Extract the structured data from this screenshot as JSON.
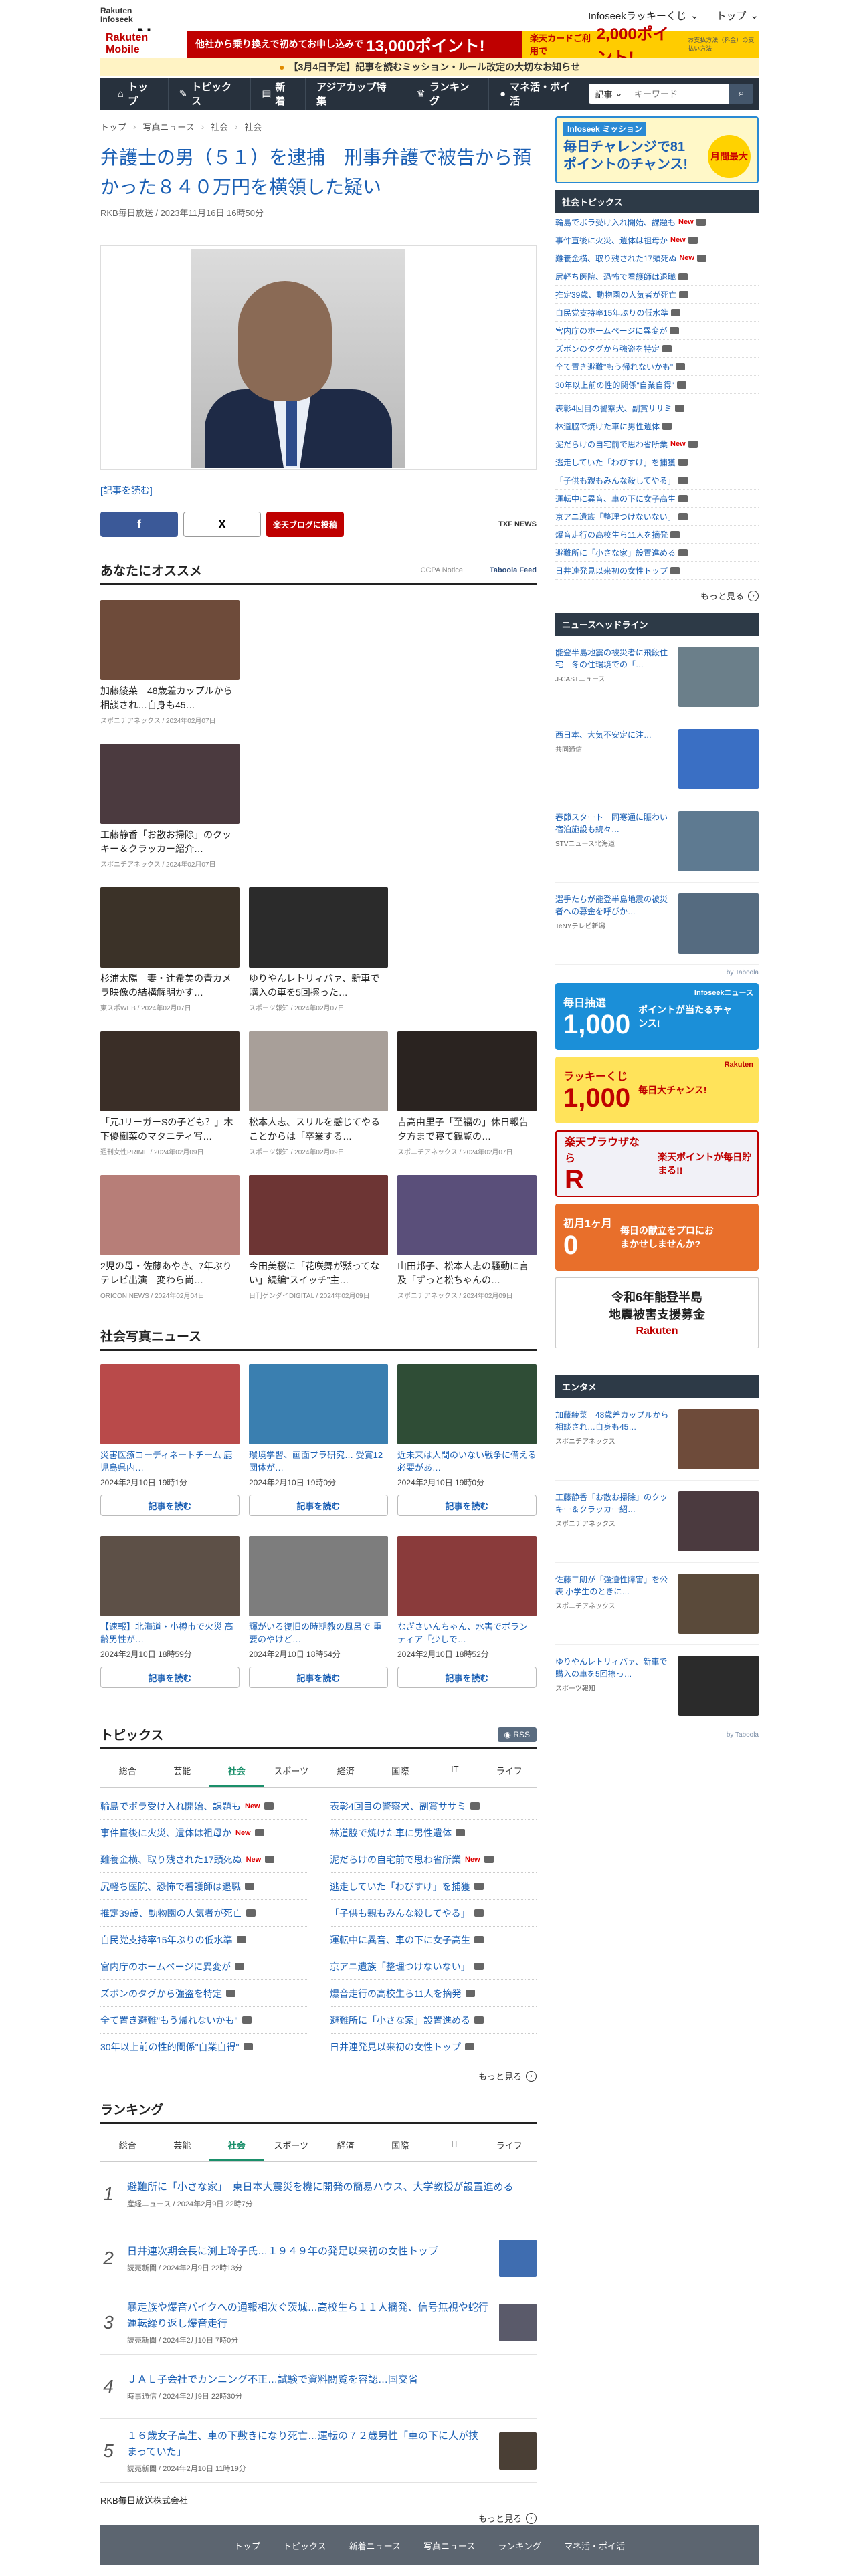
{
  "header": {
    "logo_top": "Rakuten\nInfoseek",
    "logo_main": "News",
    "lucky": "Infoseekラッキーくじ",
    "top": "トップ"
  },
  "banner": {
    "mobile": "Rakuten Mobile",
    "promo_pre": "他社から乗り換えで初めてお申し込みで",
    "promo_pts": "13,000ポイント!",
    "right_pre": "楽天カードご利用で",
    "right_pts": "2,000ポイント!",
    "right_note": "お支払方法（料金）の支払い方法"
  },
  "notice": "【3月4日予定】記事を読むミッション・ルール改定の大切なお知らせ",
  "nav": {
    "items": [
      "トップ",
      "トピックス",
      "新着",
      "アジアカップ特集",
      "ランキング",
      "マネ活・ポイ活"
    ],
    "search_select": "記事",
    "search_placeholder": "キーワード"
  },
  "article": {
    "breadcrumb": [
      "トップ",
      "写真ニュース",
      "社会",
      "社会"
    ],
    "title": "弁護士の男（５１）を逮捕　刑事弁護で被告から預かった８４０万円を横領した疑い",
    "meta": "RKB毎日放送 / 2023年11月16日 16時50分",
    "read_more": "[記事を読む]",
    "share": {
      "fb": "f",
      "x": "X",
      "blog": "楽天ブログに投稿",
      "logo": "TXF NEWS"
    }
  },
  "recommend": {
    "title": "あなたにオススメ",
    "notice": "CCPA Notice",
    "feed": "Taboola Feed",
    "cards": [
      {
        "title": "加藤綾菜　48歳差カップルから相談され…自身も45…",
        "src": "スポニチアネックス / 2024年02月07日",
        "c": "#6e4b3a"
      },
      {
        "title": "工藤静香「お散お掃除」のクッキー＆クラッカー紹介…",
        "src": "スポニチアネックス / 2024年02月07日",
        "c": "#4b3a3f"
      },
      {
        "title": "杉浦太陽　妻・辻希美の青カメラ映像の結構解明かす…",
        "src": "東スポWEB / 2024年02月07日",
        "c": "#3b3228"
      },
      {
        "title": "ゆりやんレトリィバァ、新車で購入の車を5回擦った…",
        "src": "スポーツ報知 / 2024年02月07日",
        "c": "#2b2b2b"
      },
      {
        "title": "「元JリーガーSの子ども？」木下優樹菜のマタニティ写…",
        "src": "週刊女性PRIME / 2024年02月09日",
        "c": "#3a2e27"
      },
      {
        "title": "松本人志、スリルを感じてやることからは「卒業する…",
        "src": "スポーツ報知 / 2024年02月09日",
        "c": "#a89f99"
      },
      {
        "title": "吉高由里子「至福の」休日報告　夕方まで寝て観覧の…",
        "src": "スポニチアネックス / 2024年02月07日",
        "c": "#2a2320"
      },
      {
        "title": "2児の母・佐藤あやき、7年ぶりテレビ出演　変わら尚…",
        "src": "ORICON NEWS / 2024年02月04日",
        "c": "#b77e78"
      },
      {
        "title": "今田美桜に「花咲舞が黙ってない」続編“スイッチ”主…",
        "src": "日刊ゲンダイDIGITAL / 2024年02月09日",
        "c": "#6d3534"
      },
      {
        "title": "山田邦子、松本人志の騒動に言及「ずっと松ちゃんの…",
        "src": "スポニチアネックス / 2024年02月09日",
        "c": "#5a4f7a"
      }
    ]
  },
  "photonews": {
    "title": "社会写真ニュース",
    "btn": "記事を読む",
    "items": [
      {
        "title": "災害医療コーディネートチーム 鹿児島県内…",
        "date": "2024年2月10日 19時1分",
        "c": "#b94a4a"
      },
      {
        "title": "環境学習、画面プラ研究… 受賞12団体が…",
        "date": "2024年2月10日 19時0分",
        "c": "#3a7fb0"
      },
      {
        "title": "近未来は人間のいない戦争に備える必要があ…",
        "date": "2024年2月10日 19時0分",
        "c": "#2f4d36"
      },
      {
        "title": "【速報】北海道・小樽市で火災 高齢男性が…",
        "date": "2024年2月10日 18時59分",
        "c": "#5d5047"
      },
      {
        "title": "輝がいる復旧の時期教の風呂で 重要のやけど…",
        "date": "2024年2月10日 18時54分",
        "c": "#7d7d7d"
      },
      {
        "title": "なぎさいんちゃん、水害でボランティア「少しで…",
        "date": "2024年2月10日 18時52分",
        "c": "#8a3b3b"
      }
    ]
  },
  "topics": {
    "title": "トピックス",
    "rss": "RSS",
    "tabs": [
      "総合",
      "芸能",
      "社会",
      "スポーツ",
      "経済",
      "国際",
      "IT",
      "ライフ"
    ],
    "active": "社会",
    "left": [
      {
        "t": "輪島でボラ受け入れ開始、課題も",
        "new": "New"
      },
      {
        "t": "事件直後に火災、遺体は祖母か",
        "new": "New"
      },
      {
        "t": "難養金横、取り残された17頭死ぬ",
        "new": "New"
      },
      {
        "t": "尻軽ち医院、恐怖で看護師は退職",
        "new": ""
      },
      {
        "t": "推定39歳、動物園の人気者が死亡",
        "new": ""
      },
      {
        "t": "自民党支持率15年ぶりの低水準",
        "new": ""
      },
      {
        "t": "宮内庁のホームページに異変が",
        "new": ""
      },
      {
        "t": "ズボンのタグから強盗を特定",
        "new": ""
      },
      {
        "t": "全て置き避難\"もう帰れないかも\"",
        "new": ""
      },
      {
        "t": "30年以上前の性的関係\"自業自得\"",
        "new": ""
      }
    ],
    "right": [
      {
        "t": "表彰4回目の警察犬、副賞ササミ",
        "new": ""
      },
      {
        "t": "林道脇で焼けた車に男性遺体",
        "new": ""
      },
      {
        "t": "泥だらけの自宅前で思わ省所業",
        "new": "New"
      },
      {
        "t": "逃走していた「わびすけ」を捕獲",
        "new": ""
      },
      {
        "t": "「子供も親もみんな殺してやる」",
        "new": ""
      },
      {
        "t": "運転中に異音、車の下に女子高生",
        "new": ""
      },
      {
        "t": "京アニ遺族「整理つけないない」",
        "new": ""
      },
      {
        "t": "爆音走行の高校生ら11人を摘発",
        "new": ""
      },
      {
        "t": "避難所に「小さな家」設置進める",
        "new": ""
      },
      {
        "t": "日井連発見以来初の女性トップ",
        "new": ""
      }
    ],
    "more": "もっと見る"
  },
  "ranking": {
    "title": "ランキング",
    "tabs": [
      "総合",
      "芸能",
      "社会",
      "スポーツ",
      "経済",
      "国際",
      "IT",
      "ライフ"
    ],
    "items": [
      {
        "n": "1",
        "t": "避難所に「小さな家」　東日本大震災を機に開発の簡易ハウス、大学教授が設置進める",
        "s": "産経ニュース / 2024年2月9日 22時7分",
        "c": ""
      },
      {
        "n": "2",
        "t": "日井連次期会長に渕上玲子氏…１９４９年の発足以来初の女性トップ",
        "s": "読売新聞 / 2024年2月9日 22時13分",
        "c": "#3f6db0"
      },
      {
        "n": "3",
        "t": "暴走族や爆音バイクへの通報相次ぐ茨城…高校生ら１１人摘発、信号無視や蛇行運転繰り返し爆音走行",
        "s": "読売新聞 / 2024年2月10日 7時0分",
        "c": "#5a5a6a"
      },
      {
        "n": "4",
        "t": "ＪＡＬ子会社でカンニング不正…試験で資料閲覧を容認…国交省",
        "s": "時事通信 / 2024年2月9日 22時30分",
        "c": ""
      },
      {
        "n": "5",
        "t": "１６歳女子高生、車の下敷きになり死亡…運転の７２歳男性「車の下に人が挟まっていた」",
        "s": "読売新聞 / 2024年2月10日 11時19分",
        "c": "#4a3f35"
      }
    ],
    "source": "RKB毎日放送株式会社",
    "more": "もっと見る"
  },
  "sidebar": {
    "mission": {
      "title": "Infoseek ミッション",
      "sub": "毎日チャレンジで81ポイントのチャンス!",
      "badge": "月間最大"
    },
    "social_title": "社会トピックス",
    "social": [
      {
        "t": "輪島でボラ受け入れ開始、課題も",
        "new": "New"
      },
      {
        "t": "事件直後に火災、遺体は祖母か",
        "new": "New"
      },
      {
        "t": "難養金横、取り残された17頭死ぬ",
        "new": "New"
      },
      {
        "t": "尻軽ち医院、恐怖で看護師は退職",
        "new": ""
      },
      {
        "t": "推定39歳、動物園の人気者が死亡",
        "new": ""
      },
      {
        "t": "自民党支持率15年ぶりの低水準",
        "new": ""
      },
      {
        "t": "宮内庁のホームページに異変が",
        "new": ""
      },
      {
        "t": "ズボンのタグから強盗を特定",
        "new": ""
      },
      {
        "t": "全て置き避難\"もう帰れないかも\"",
        "new": ""
      },
      {
        "t": "30年以上前の性的関係\"自業自得\"",
        "new": ""
      },
      {
        "t": "表彰4回目の警察犬、副賞ササミ",
        "new": ""
      },
      {
        "t": "林道脇で焼けた車に男性遺体",
        "new": ""
      },
      {
        "t": "泥だらけの自宅前で思わ省所業",
        "new": "New"
      },
      {
        "t": "逃走していた「わびすけ」を捕獲",
        "new": ""
      },
      {
        "t": "「子供も親もみんな殺してやる」",
        "new": ""
      },
      {
        "t": "運転中に異音、車の下に女子高生",
        "new": ""
      },
      {
        "t": "京アニ遺族「整理つけないない」",
        "new": ""
      },
      {
        "t": "爆音走行の高校生ら11人を摘発",
        "new": ""
      },
      {
        "t": "避難所に「小さな家」設置進める",
        "new": ""
      },
      {
        "t": "日井連発見以来初の女性トップ",
        "new": ""
      }
    ],
    "more": "もっと見る",
    "headline_title": "ニュースヘッドライン",
    "headlines": [
      {
        "t": "能登半島地震の被災者に飛段住宅　冬の住環境での「…",
        "s": "J-CASTニュース",
        "c": "#6b7f8a"
      },
      {
        "t": "西日本、大気不安定に注…",
        "s": "共同通信",
        "c": "#3a6fc4"
      },
      {
        "t": "春節スタート　同寒通に賑わい　宿泊施設も続々…",
        "s": "STVニュース北海道",
        "c": "#5e7a91"
      },
      {
        "t": "選手たちが能登半島地震の被災者への募金を呼びか…",
        "s": "TeNYテレビ新潟",
        "c": "#556b80"
      }
    ],
    "taboola": "by Taboola",
    "promos": [
      {
        "big": "1,000",
        "top": "毎日抽選",
        "sub": "ポイントが当たるチャンス!",
        "brand": "Infoseekニュース",
        "bg": "#1b8fd8"
      },
      {
        "big": "1,000",
        "top": "ラッキーくじ",
        "sub": "毎日大チャンス!",
        "brand": "Rakuten",
        "bg": "#ffe35a"
      },
      {
        "big": "R",
        "top": "楽天ブラウザなら",
        "sub": "楽天ポイントが毎日貯まる!!",
        "brand": "",
        "bg": "#f1f1f7"
      },
      {
        "big": "0",
        "top": "初月1ヶ月",
        "sub": "毎日の献立をプロにおまかせしませんか?",
        "brand": "",
        "bg": "#e86f2b"
      }
    ],
    "donate": {
      "l1": "令和6年能登半島",
      "l2": "地震被害支援募金",
      "brand": "Rakuten"
    },
    "enta_title": "エンタメ",
    "enta": [
      {
        "t": "加藤綾菜　48歳差カップルから相談され…自身も45…",
        "s": "スポニチアネックス",
        "c": "#6e4b3a"
      },
      {
        "t": "工藤静香「お散お掃除」のクッキー＆クラッカー紹…",
        "s": "スポニチアネックス",
        "c": "#4b3a3f"
      },
      {
        "t": "佐藤二朗が「強迫性障害」を公表 小学生のときに…",
        "s": "スポニチアネックス",
        "c": "#5a4a3a"
      },
      {
        "t": "ゆりやんレトリィバァ、新車で購入の車を5回擦っ…",
        "s": "スポーツ報知",
        "c": "#2b2b2b"
      }
    ]
  },
  "footer": [
    "トップ",
    "トピックス",
    "新着ニュース",
    "写真ニュース",
    "ランキング",
    "マネ活・ポイ活"
  ]
}
